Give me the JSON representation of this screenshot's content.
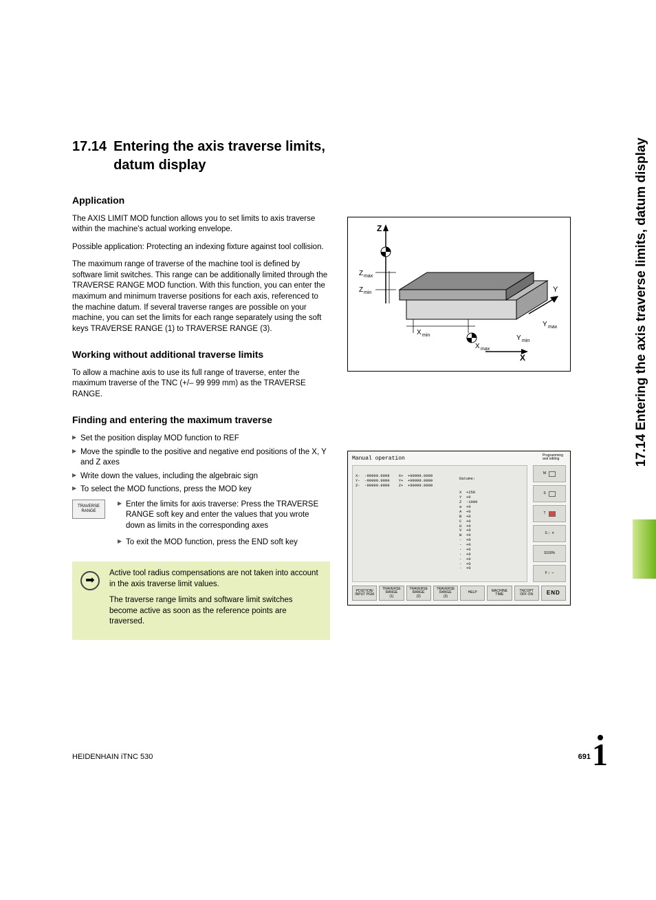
{
  "section": {
    "number": "17.14",
    "title": "Entering the axis traverse limits, datum display"
  },
  "h_application": "Application",
  "p1": "The AXIS LIMIT MOD function allows you to set limits to axis traverse within the machine's actual working envelope.",
  "p2": "Possible application: Protecting an indexing fixture against tool collision.",
  "p3": "The maximum range of traverse of the machine tool is defined by software limit switches. This range can be additionally limited through the TRAVERSE RANGE MOD function. With this function, you can enter the maximum and minimum traverse positions for each axis, referenced to the machine datum. If several traverse ranges are possible on your machine, you can set the limits for each range separately using the soft keys TRAVERSE RANGE (1) to TRAVERSE RANGE (3).",
  "h_working": "Working without additional traverse limits",
  "p4": "To allow a machine axis to use its full range of traverse, enter the maximum traverse of the TNC (+/– 99 999 mm) as the TRAVERSE RANGE.",
  "h_finding": "Finding and entering the maximum traverse",
  "steps": [
    "Set the position display MOD function to REF",
    "Move the spindle to the positive and negative end positions of the X, Y and Z axes",
    "Write down the values, including the algebraic sign",
    "To select the MOD functions, press the MOD key"
  ],
  "softkey_label": "TRAVERSE\nRANGE",
  "softkey_steps": [
    "Enter the limits for axis traverse: Press the TRAVERSE RANGE soft key and enter the values that you wrote down as limits in the corresponding axes",
    "To exit the MOD function, press the END soft key"
  ],
  "note": {
    "p1": "Active tool radius compensations are not taken into account in the axis traverse limit values.",
    "p2": "The traverse range limits and software limit switches become active as soon as the reference points are traversed."
  },
  "fig1": {
    "Z": "Z",
    "X": "X",
    "Y": "Y",
    "Zmax": "Zmax",
    "Zmin": "Zmin",
    "Xmin": "Xmin",
    "Xmax": "Xmax",
    "Ymin": "Ymin",
    "Ymax": "Ymax"
  },
  "fig2": {
    "title": "Manual operation",
    "mode": "Programming\nand editing",
    "coords": "X-  -99999.9999    X+  +99999.9999\nY-  -99999.9999    Y+  +99999.9999\nZ-  -99999.9999    Z+  +99999.9999",
    "datums_label": "Datums:",
    "datums": "X  +250\nY  +0\nZ  -1000\na  +0\nA  +0\nB  +0\nC  +0\nU  +0\nV  +0\nW  +0\n-  +0\n-  +0\n-  +0\n-  +0\n-  +0\n-  +0\n-  +0",
    "softkeys": [
      "POSITION/\nINPUT PGM",
      "TRAVERSE\nRANGE\n(1)",
      "TRAVERSE\nRANGE\n(2)",
      "TRAVERSE\nRANGE\n(3)",
      "HELP",
      "MACHINE\nTIME",
      "TNCOPT\nOFF  ON",
      "END"
    ],
    "side_labels": [
      "M",
      "S",
      "T",
      "S ↕",
      "S100%",
      "F ↕"
    ]
  },
  "side_title": "17.14 Entering the axis traverse limits, datum display",
  "footer": {
    "product": "HEIDENHAIN iTNC 530",
    "page": "691"
  }
}
